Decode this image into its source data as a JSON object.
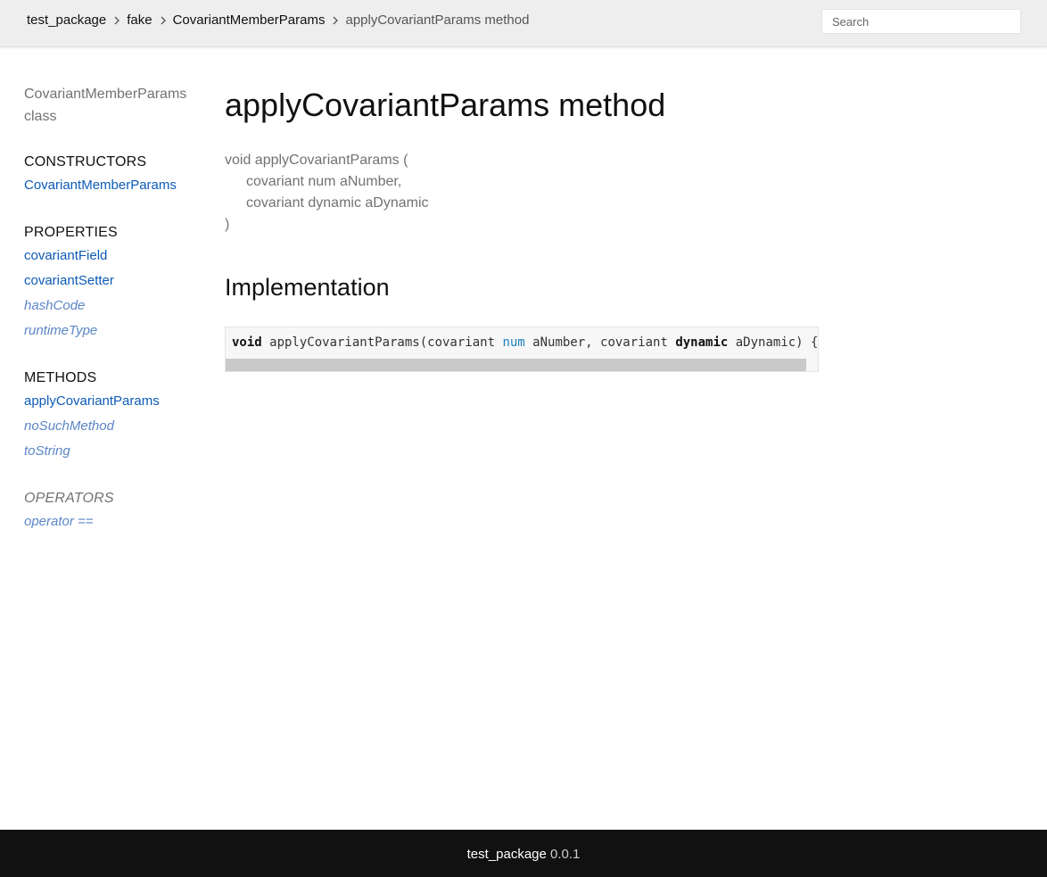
{
  "breadcrumbs": [
    {
      "label": "test_package"
    },
    {
      "label": "fake"
    },
    {
      "label": "CovariantMemberParams"
    }
  ],
  "breadcrumb_current": "applyCovariantParams method",
  "search": {
    "placeholder": "Search"
  },
  "sidebar": {
    "class_name": "CovariantMemberParams",
    "class_kind": "class",
    "constructors_heading": "CONSTRUCTORS",
    "constructors": [
      "CovariantMemberParams"
    ],
    "properties_heading": "PROPERTIES",
    "properties": [
      {
        "label": "covariantField",
        "inherited": false
      },
      {
        "label": "covariantSetter",
        "inherited": false
      },
      {
        "label": "hashCode",
        "inherited": true
      },
      {
        "label": "runtimeType",
        "inherited": true
      }
    ],
    "methods_heading": "METHODS",
    "methods": [
      {
        "label": "applyCovariantParams",
        "inherited": false
      },
      {
        "label": "noSuchMethod",
        "inherited": true
      },
      {
        "label": "toString",
        "inherited": true
      }
    ],
    "operators_heading": "OPERATORS",
    "operators": [
      {
        "label": "operator ==",
        "inherited": true
      }
    ]
  },
  "main": {
    "title": "applyCovariantParams method",
    "signature": {
      "head": "void applyCovariantParams (",
      "params": [
        "covariant num aNumber,",
        "covariant dynamic aDynamic"
      ],
      "tail": ")"
    },
    "implementation_heading": "Implementation",
    "code": {
      "kw_void": "void",
      "part1": " applyCovariantParams(covariant ",
      "type_num": "num",
      "part2": " aNumber, covariant ",
      "kw_dynamic": "dynamic",
      "part3": " aDynamic) {"
    }
  },
  "footer": {
    "package": "test_package",
    "version": "0.0.1"
  },
  "colors": {
    "link": "#0d5bb8",
    "inherited_link": "#5b86c6",
    "header_bg": "#eeeeee",
    "footer_bg": "#111111"
  }
}
